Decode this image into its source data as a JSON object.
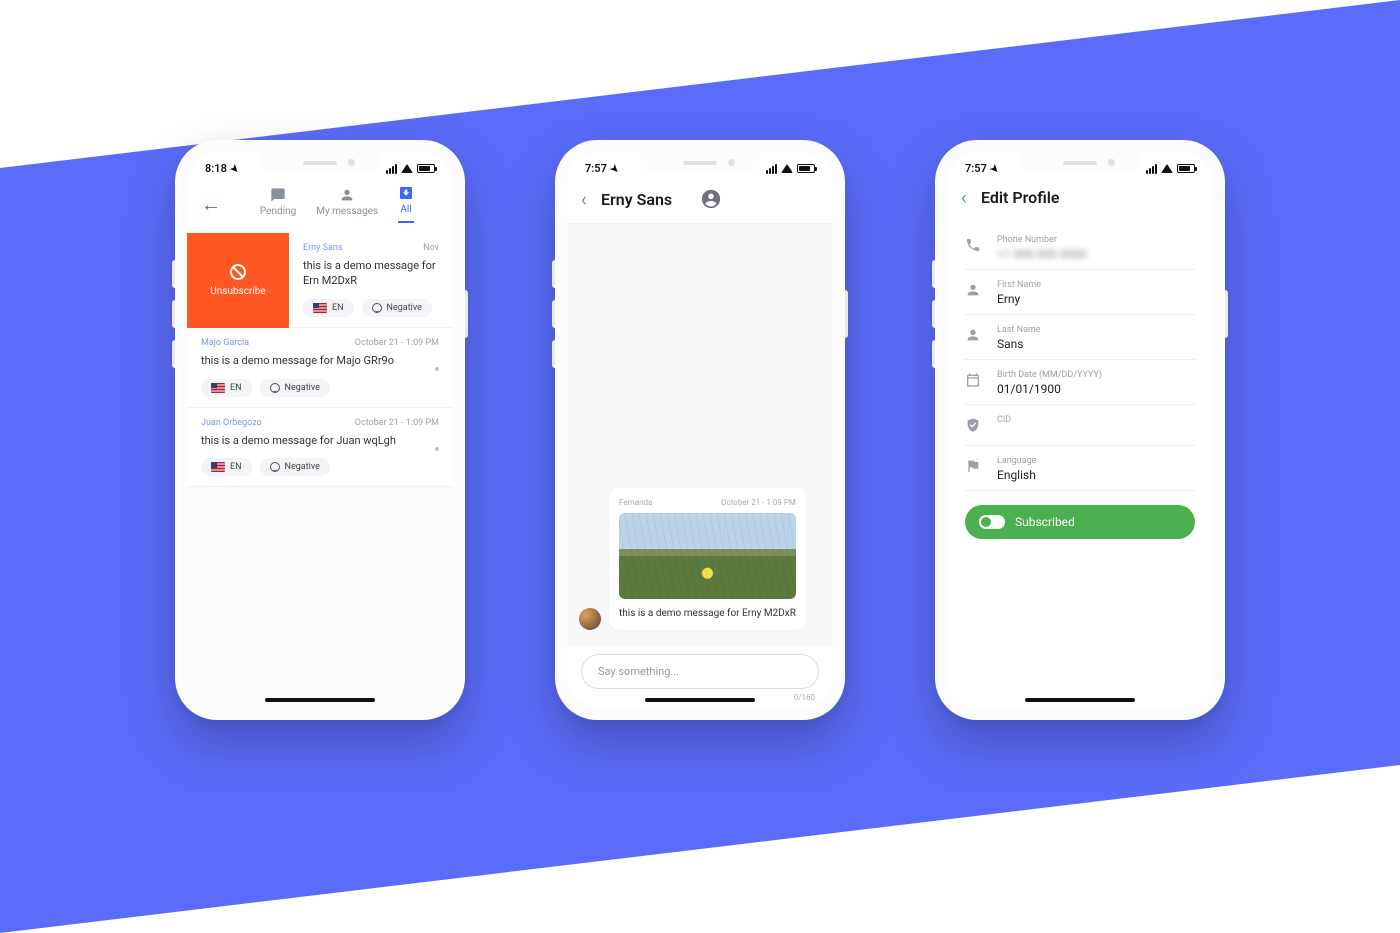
{
  "phone1": {
    "status_time": "8:18",
    "tabs": [
      {
        "label": "Pending",
        "active": false
      },
      {
        "label": "My messages",
        "active": false
      },
      {
        "label": "All",
        "active": true
      }
    ],
    "unsubscribe_label": "Unsubscribe",
    "messages": [
      {
        "sender": "Erny Sans",
        "date": "Nov",
        "body": "this is a demo message for Ern M2DxR",
        "lang": "EN",
        "sentiment": "Negative",
        "swiped": true
      },
      {
        "sender": "Majo Garcia",
        "date": "October 21  -  1:09 PM",
        "body": "this is a demo message for Majo GRr9o",
        "lang": "EN",
        "sentiment": "Negative",
        "swiped": false
      },
      {
        "sender": "Juan Orbegozo",
        "date": "October 21  -  1:09 PM",
        "body": "this is a demo message for Juan wqLgh",
        "lang": "EN",
        "sentiment": "Negative",
        "swiped": false
      }
    ]
  },
  "phone2": {
    "status_time": "7:57",
    "title": "Erny Sans",
    "bubble": {
      "sender": "Fernanda",
      "date": "October 21 - 1:09 PM",
      "text": "this is a demo message for Erny M2DxR"
    },
    "compose_placeholder": "Say something...",
    "counter": "0/160"
  },
  "phone3": {
    "status_time": "7:57",
    "title": "Edit Profile",
    "fields": {
      "phone_label": "Phone Number",
      "phone_value": "+1 000 000 0000",
      "first_label": "First Name",
      "first_value": "Erny",
      "last_label": "Last Name",
      "last_value": "Sans",
      "birth_label": "Birth Date (MM/DD/YYYY)",
      "birth_value": "01/01/1900",
      "cid_label": "CID",
      "cid_value": "",
      "lang_label": "Language",
      "lang_value": "English"
    },
    "subscribed_label": "Subscribed"
  }
}
